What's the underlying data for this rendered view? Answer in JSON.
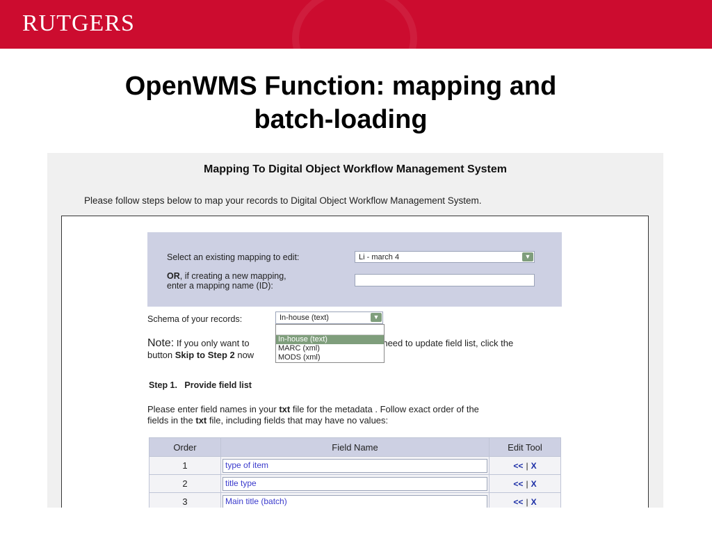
{
  "header": {
    "logo_text": "RUTGERS",
    "brand_color": "#cc0c2f"
  },
  "slide": {
    "title_line1": "OpenWMS Function: mapping and",
    "title_line2": "batch-loading"
  },
  "app": {
    "heading": "Mapping To Digital Object Workflow Management System",
    "intro": "Please follow steps below to map your records to Digital Object Workflow Management System.",
    "mapping": {
      "select_label": "Select an existing mapping to edit:",
      "selected_mapping": "Li - march 4",
      "or_label": "OR",
      "or_rest_line1": ", if creating a new mapping,",
      "or_rest_line2": "enter a mapping name (ID):",
      "new_mapping_value": ""
    },
    "schema": {
      "label": "Schema of your records:",
      "selected": "In-house (text)",
      "options": [
        "In-house (text)",
        "MARC (xml)",
        "MODS (xml)"
      ]
    },
    "note": {
      "head": "Note:",
      "text_a": " If you only want to",
      "text_b": "not need to update field list, click the",
      "line2_a": "button ",
      "line2_bold": "Skip to Step 2",
      "line2_b": " now"
    },
    "step1": {
      "title": "Step 1.   Provide field list",
      "instr_a": "Please enter field names in your ",
      "instr_bold1": "txt",
      "instr_b": " file for the metadata .   Follow exact order of the",
      "instr_c": "fields in the ",
      "instr_bold2": "txt",
      "instr_d": " file, including fields that may have no values:"
    },
    "table": {
      "headers": [
        "Order",
        "Field Name",
        "Edit Tool"
      ],
      "rows": [
        {
          "order": "1",
          "field": "type of item",
          "move": "<<",
          "sep": "|",
          "delete": "X"
        },
        {
          "order": "2",
          "field": "title type",
          "move": "<<",
          "sep": "|",
          "delete": "X"
        },
        {
          "order": "3",
          "field": "Main title (batch)",
          "move": "<<",
          "sep": "|",
          "delete": "X"
        }
      ]
    },
    "colors": {
      "panel": "#cdd0e3",
      "selected_option": "#7f9e7c",
      "link": "#1a2da6"
    }
  }
}
